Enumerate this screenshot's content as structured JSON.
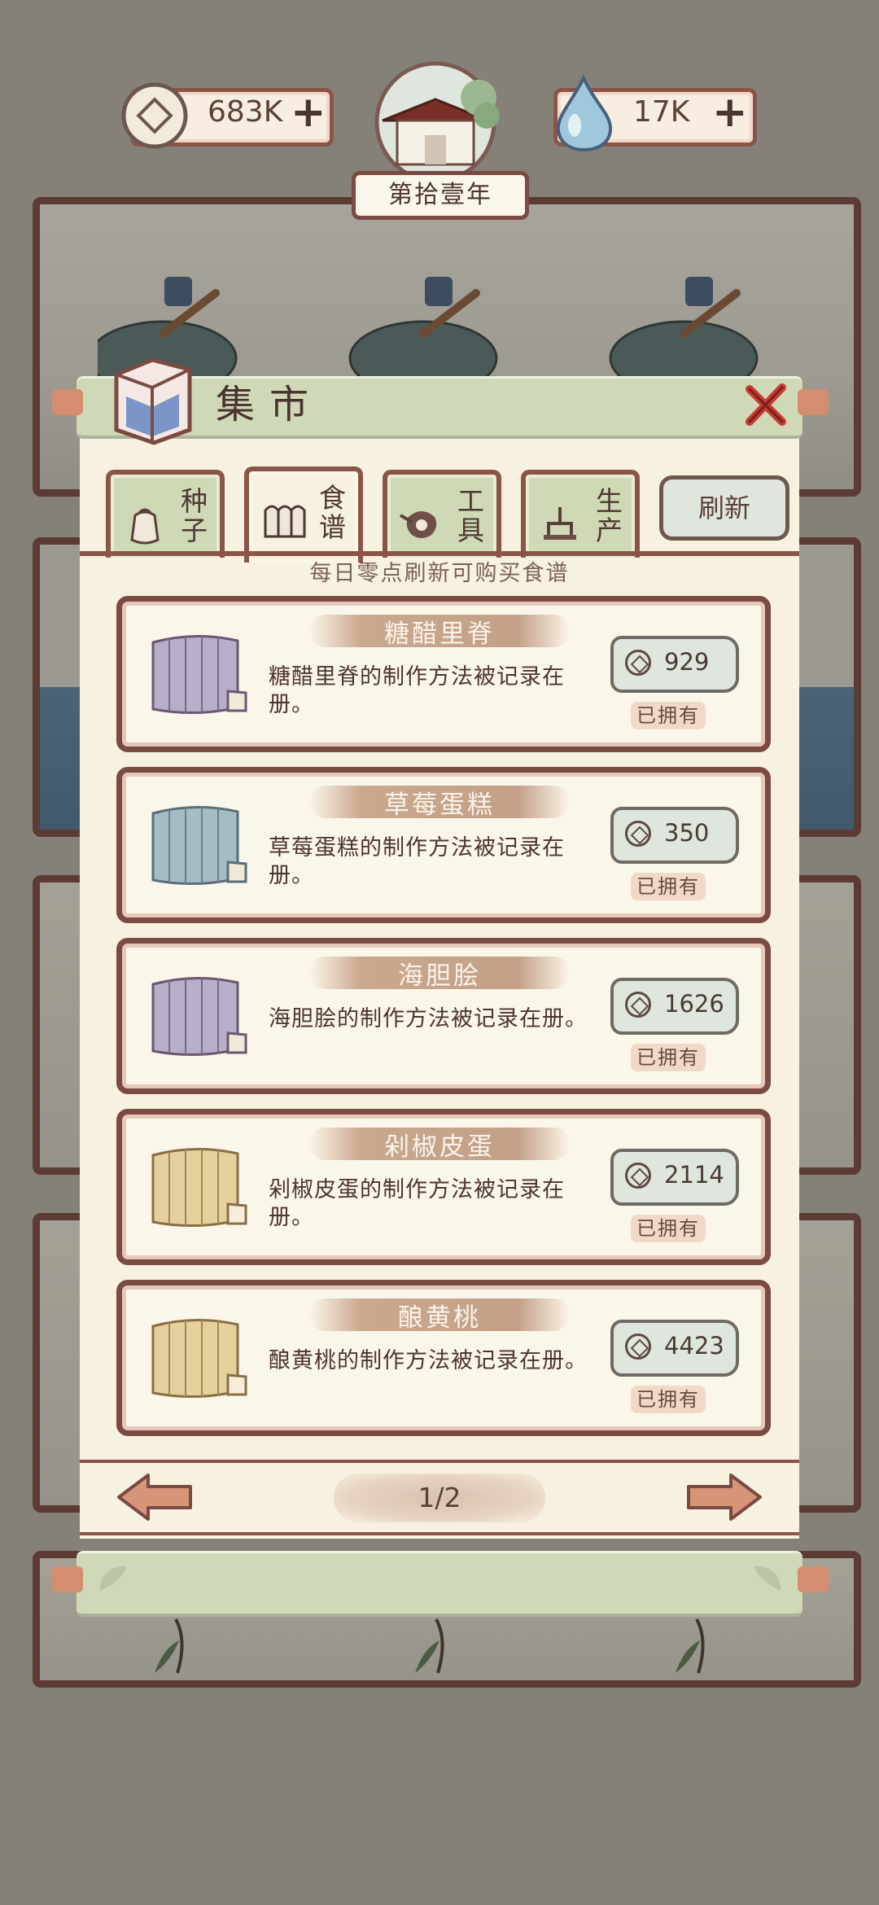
{
  "header": {
    "coins": "683K",
    "water": "17K",
    "year": "第拾壹年"
  },
  "market": {
    "title": "集市",
    "tabs": [
      {
        "label_1": "种",
        "label_2": "子",
        "icon": "seed-bag-icon"
      },
      {
        "label_1": "食",
        "label_2": "谱",
        "icon": "recipe-book-icon"
      },
      {
        "label_1": "工",
        "label_2": "具",
        "icon": "tools-icon"
      },
      {
        "label_1": "生",
        "label_2": "产",
        "icon": "production-icon"
      }
    ],
    "refresh_label": "刷新",
    "notice": "每日零点刷新可购买食谱",
    "recipes": [
      {
        "name": "糖醋里脊",
        "desc": "糖醋里脊的制作方法被记录在册。",
        "price": "929",
        "status": "已拥有",
        "scroll_color": "#b7aec9"
      },
      {
        "name": "草莓蛋糕",
        "desc": "草莓蛋糕的制作方法被记录在册。",
        "price": "350",
        "status": "已拥有",
        "scroll_color": "#a6bcc4"
      },
      {
        "name": "海胆脍",
        "desc": "海胆脍的制作方法被记录在册。",
        "price": "1626",
        "status": "已拥有",
        "scroll_color": "#b7aec9"
      },
      {
        "name": "剁椒皮蛋",
        "desc": "剁椒皮蛋的制作方法被记录在册。",
        "price": "2114",
        "status": "已拥有",
        "scroll_color": "#e6d19c"
      },
      {
        "name": "酿黄桃",
        "desc": "酿黄桃的制作方法被记录在册。",
        "price": "4423",
        "status": "已拥有",
        "scroll_color": "#e6d19c"
      }
    ],
    "pager": {
      "text": "1/2"
    }
  },
  "colors": {
    "frame": "#8a5548",
    "panel": "#f7f1df",
    "title_bar": "#cfd9b7",
    "close": "#c63a32"
  }
}
